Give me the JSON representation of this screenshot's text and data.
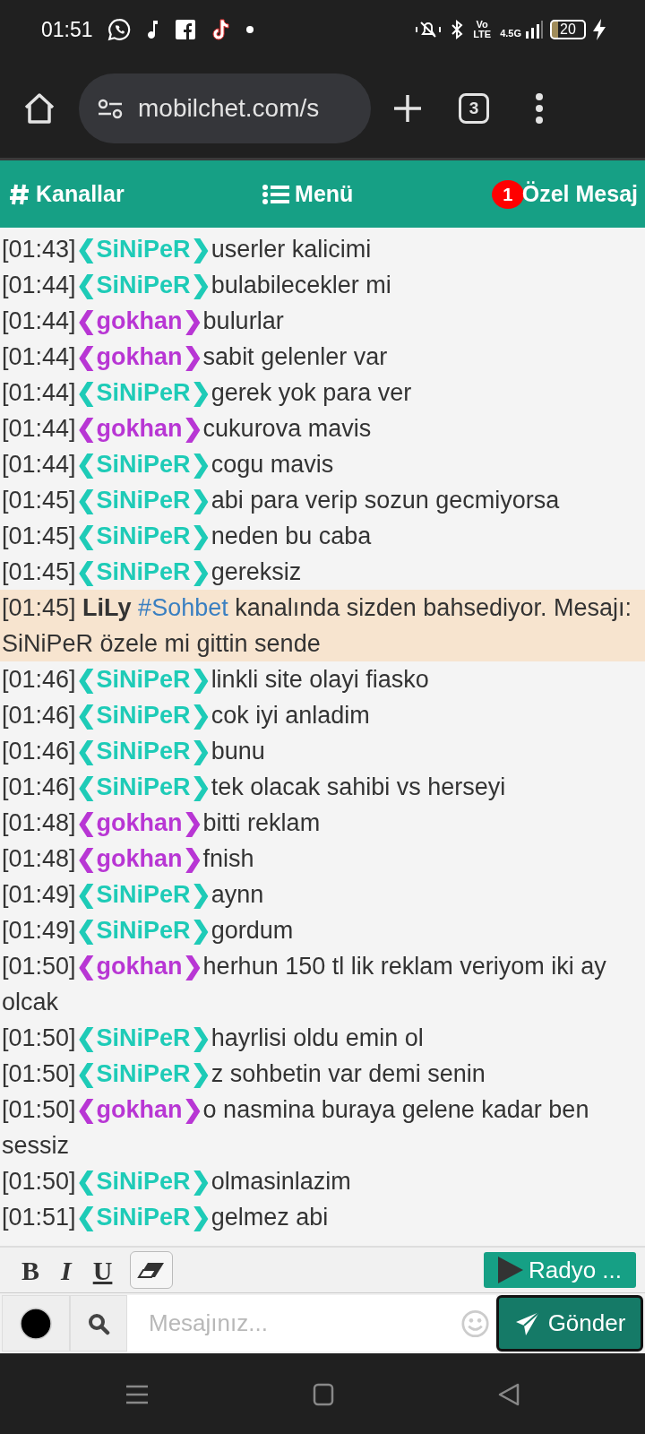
{
  "status_bar": {
    "time": "01:51",
    "network_label": "Vo LTE",
    "generation": "4.5G",
    "battery_text": "20"
  },
  "browser": {
    "url": "mobilchet.com/s",
    "tab_count": "3"
  },
  "nav": [
    {
      "kind": "channels",
      "label": "Kanallar"
    },
    {
      "kind": "menu",
      "label": "Menü"
    },
    {
      "kind": "private",
      "label": "Özel Mesaj",
      "badge": "1"
    }
  ],
  "messages": [
    {
      "kind": "chat",
      "time": "[01:43]",
      "nick": "❮SiNiPeR❯",
      "color": "#1ecbb7",
      "text": "userler kalicimi"
    },
    {
      "kind": "chat",
      "time": "[01:44]",
      "nick": "❮SiNiPeR❯",
      "color": "#1ecbb7",
      "text": "bulabilecekler mi"
    },
    {
      "kind": "chat",
      "time": "[01:44]",
      "nick": "❮gokhan❯",
      "color": "#b836d4",
      "text": "bulurlar"
    },
    {
      "kind": "chat",
      "time": "[01:44]",
      "nick": "❮gokhan❯",
      "color": "#b836d4",
      "text": "sabit gelenler var"
    },
    {
      "kind": "chat",
      "time": "[01:44]",
      "nick": "❮SiNiPeR❯",
      "color": "#1ecbb7",
      "text": "gerek yok para ver"
    },
    {
      "kind": "chat",
      "time": "[01:44]",
      "nick": "❮gokhan❯",
      "color": "#b836d4",
      "text": "cukurova mavis"
    },
    {
      "kind": "chat",
      "time": "[01:44]",
      "nick": "❮SiNiPeR❯",
      "color": "#1ecbb7",
      "text": "cogu mavis"
    },
    {
      "kind": "chat",
      "time": "[01:45]",
      "nick": "❮SiNiPeR❯",
      "color": "#1ecbb7",
      "text": "abi para verip sozun gecmiyorsa"
    },
    {
      "kind": "chat",
      "time": "[01:45]",
      "nick": "❮SiNiPeR❯",
      "color": "#1ecbb7",
      "text": "neden bu caba"
    },
    {
      "kind": "chat",
      "time": "[01:45]",
      "nick": "❮SiNiPeR❯",
      "color": "#1ecbb7",
      "text": "gereksiz"
    },
    {
      "kind": "mention",
      "time": "[01:45]",
      "nick": "LiLy",
      "channel": "#Sohbet",
      "text": "kanalında sizden bahsediyor. Mesajı: SiNiPeR özele mi gittin sende"
    },
    {
      "kind": "chat",
      "time": "[01:46]",
      "nick": "❮SiNiPeR❯",
      "color": "#1ecbb7",
      "text": "linkli site olayi fiasko"
    },
    {
      "kind": "chat",
      "time": "[01:46]",
      "nick": "❮SiNiPeR❯",
      "color": "#1ecbb7",
      "text": "cok iyi anladim"
    },
    {
      "kind": "chat",
      "time": "[01:46]",
      "nick": "❮SiNiPeR❯",
      "color": "#1ecbb7",
      "text": "bunu"
    },
    {
      "kind": "chat",
      "time": "[01:46]",
      "nick": "❮SiNiPeR❯",
      "color": "#1ecbb7",
      "text": "tek olacak sahibi vs herseyi"
    },
    {
      "kind": "chat",
      "time": "[01:48]",
      "nick": "❮gokhan❯",
      "color": "#b836d4",
      "text": "bitti reklam"
    },
    {
      "kind": "chat",
      "time": "[01:48]",
      "nick": "❮gokhan❯",
      "color": "#b836d4",
      "text": "fnish"
    },
    {
      "kind": "chat",
      "time": "[01:49]",
      "nick": "❮SiNiPeR❯",
      "color": "#1ecbb7",
      "text": "aynn"
    },
    {
      "kind": "chat",
      "time": "[01:49]",
      "nick": "❮SiNiPeR❯",
      "color": "#1ecbb7",
      "text": "gordum"
    },
    {
      "kind": "chat",
      "time": "[01:50]",
      "nick": "❮gokhan❯",
      "color": "#b836d4",
      "text": "herhun 150 tl lik reklam veriyom iki ay olcak"
    },
    {
      "kind": "chat",
      "time": "[01:50]",
      "nick": "❮SiNiPeR❯",
      "color": "#1ecbb7",
      "text": "hayrlisi oldu emin ol"
    },
    {
      "kind": "chat",
      "time": "[01:50]",
      "nick": "❮SiNiPeR❯",
      "color": "#1ecbb7",
      "text": "z sohbetin var demi senin"
    },
    {
      "kind": "chat",
      "time": "[01:50]",
      "nick": "❮gokhan❯",
      "color": "#b836d4",
      "text": "o nasmina buraya gelene kadar ben sessiz"
    },
    {
      "kind": "chat",
      "time": "[01:50]",
      "nick": "❮SiNiPeR❯",
      "color": "#1ecbb7",
      "text": "olmasinlazim"
    },
    {
      "kind": "chat",
      "time": "[01:51]",
      "nick": "❮SiNiPeR❯",
      "color": "#1ecbb7",
      "text": "gelmez abi"
    }
  ],
  "format_bar": {
    "bold": "B",
    "italic": "I",
    "underline": "U",
    "radio_button": "Radyo ..."
  },
  "composer": {
    "color": "#000000",
    "placeholder": "Mesajınız...",
    "send_label": "Gönder"
  }
}
